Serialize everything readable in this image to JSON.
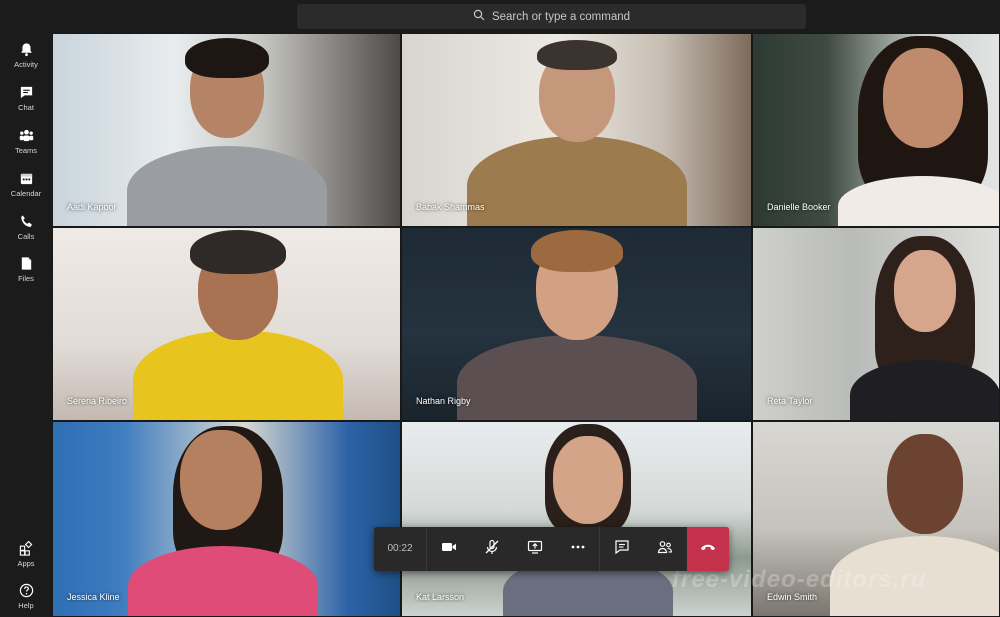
{
  "search": {
    "placeholder": "Search or type a command"
  },
  "rail_top": [
    {
      "label": "Activity",
      "icon": "bell-icon"
    },
    {
      "label": "Chat",
      "icon": "chat-icon"
    },
    {
      "label": "Teams",
      "icon": "teams-icon"
    },
    {
      "label": "Calendar",
      "icon": "calendar-icon"
    },
    {
      "label": "Calls",
      "icon": "phone-icon"
    },
    {
      "label": "Files",
      "icon": "file-icon"
    }
  ],
  "rail_bottom": [
    {
      "label": "Apps",
      "icon": "apps-icon"
    },
    {
      "label": "Help",
      "icon": "help-icon"
    }
  ],
  "participants": [
    {
      "name": "Aadi Kapoor"
    },
    {
      "name": "Babak Shammas"
    },
    {
      "name": "Danielle Booker"
    },
    {
      "name": "Serena Ribeiro"
    },
    {
      "name": "Nathan Rigby"
    },
    {
      "name": "Reta Taylor"
    },
    {
      "name": "Jessica Kline"
    },
    {
      "name": "Kat Larsson"
    },
    {
      "name": "Edwin Smith"
    }
  ],
  "controls": {
    "timer": "00:22",
    "buttons": [
      "camera-icon",
      "mic-off-icon",
      "share-screen-icon",
      "more-icon",
      "chat-icon",
      "participants-icon"
    ],
    "hangup": "hangup-icon"
  },
  "watermark": "free-video-editors.ru",
  "colors": {
    "hangup": "#c4314b",
    "rail": "#1b1b1b",
    "search": "#2b2b2b"
  }
}
